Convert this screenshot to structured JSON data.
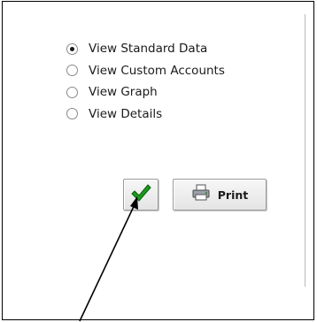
{
  "options": [
    {
      "label": "View Standard Data",
      "checked": true
    },
    {
      "label": "View Custom Accounts",
      "checked": false
    },
    {
      "label": "View Graph",
      "checked": false
    },
    {
      "label": "View Details",
      "checked": false
    }
  ],
  "buttons": {
    "ok_icon": "checkmark-icon",
    "print_icon": "printer-icon",
    "print_label": "Print"
  },
  "colors": {
    "check_green": "#1c9a1c",
    "frame_border": "#000000"
  }
}
